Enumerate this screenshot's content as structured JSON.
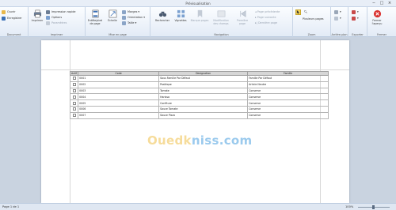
{
  "window": {
    "title": "Prévisualisation",
    "buttons": [
      "−",
      "□",
      "×"
    ]
  },
  "ribbon": {
    "groups": {
      "document": {
        "label": "Document",
        "open": "Ouvrir",
        "save": "Enregistrer"
      },
      "print": {
        "label": "Imprimer",
        "print": "Imprimer",
        "quick_print": "Impression rapide",
        "options": "Options",
        "parameters": "Paramètres"
      },
      "page_setup": {
        "label": "Mise en page",
        "header_footer": "Entête/pied de page",
        "scale": "Échelle",
        "margins": "Marges",
        "orientation": "Orientation",
        "size": "Taille"
      },
      "navigation": {
        "label": "Navigation",
        "find": "Rechercher",
        "thumbnails": "Vignettes",
        "bookmarks": "Marque-pages",
        "editing_fields": "Modification des champs",
        "first_page": "Première page",
        "previous_page": "Page précédente",
        "next_page": "Page suivante",
        "last_page": "Dernière page"
      },
      "zoom": {
        "label": "Zoom",
        "pointer": "Pointeur",
        "multiple_pages": "Plusieurs pages"
      },
      "background": {
        "label": "Arrière-plan"
      },
      "export": {
        "label": "Exporter"
      },
      "close": {
        "label": "Fermer",
        "close": "Fermer l'aperçu"
      }
    }
  },
  "report": {
    "headers": [
      "Actif",
      "Code",
      "Designation",
      "Famille"
    ],
    "rows": [
      [
        "",
        "0001",
        "Sous Famille Par Défaut",
        "Famille Par Défaut"
      ],
      [
        "",
        "0002",
        "Pastèque",
        "Article Neutre"
      ],
      [
        "",
        "0003",
        "Tomate",
        "Conserve"
      ],
      [
        "",
        "0004",
        "Harissa",
        "Conserve"
      ],
      [
        "",
        "0005",
        "Confiture",
        "Conserve"
      ],
      [
        "",
        "0006",
        "Sauce Tomate",
        "Conserve"
      ],
      [
        "",
        "0007",
        "Sauce Pizza",
        "Conserve"
      ]
    ]
  },
  "watermark": {
    "part1": "Ouedk",
    "part2": "niss.com"
  },
  "status": {
    "page": "Page 1 de 1",
    "zoom": "100%"
  },
  "colors": {
    "accent": "#2b5797",
    "header_bg": "#d6d6d6",
    "close_red": "#d9312f"
  }
}
